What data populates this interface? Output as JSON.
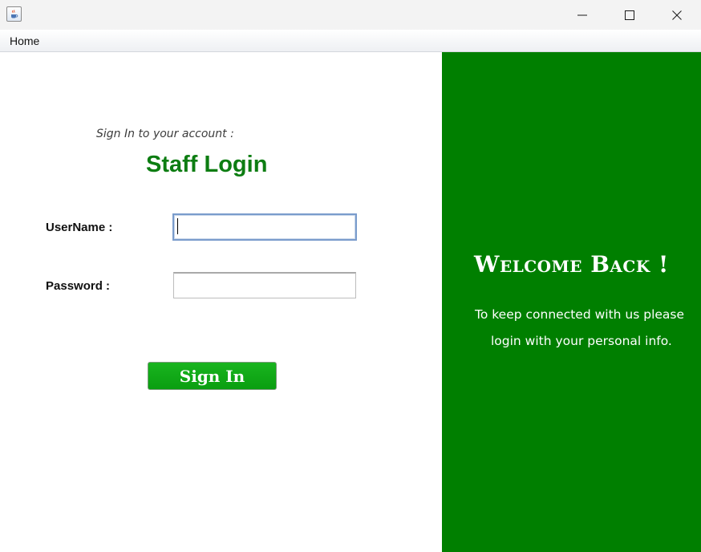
{
  "menubar": {
    "items": [
      {
        "label": "Home"
      }
    ]
  },
  "login_form": {
    "subtitle": "Sign In to your account :",
    "title": "Staff Login",
    "username_label": "UserName :",
    "username_value": "",
    "password_label": "Password :",
    "password_value": "",
    "signin_label": "Sign In"
  },
  "welcome": {
    "title": "Welcome Back !",
    "line1": "To keep connected with us please",
    "line2": "login with your personal info."
  },
  "icons": {
    "app": "java-coffee-cup-icon",
    "minimize": "minimize-icon",
    "maximize": "maximize-icon",
    "close": "close-icon"
  },
  "colors": {
    "brand_green": "#007f00",
    "title_green": "#0d7d12",
    "button_green": "#10a816",
    "titlebar_bg": "#f3f3f3"
  }
}
